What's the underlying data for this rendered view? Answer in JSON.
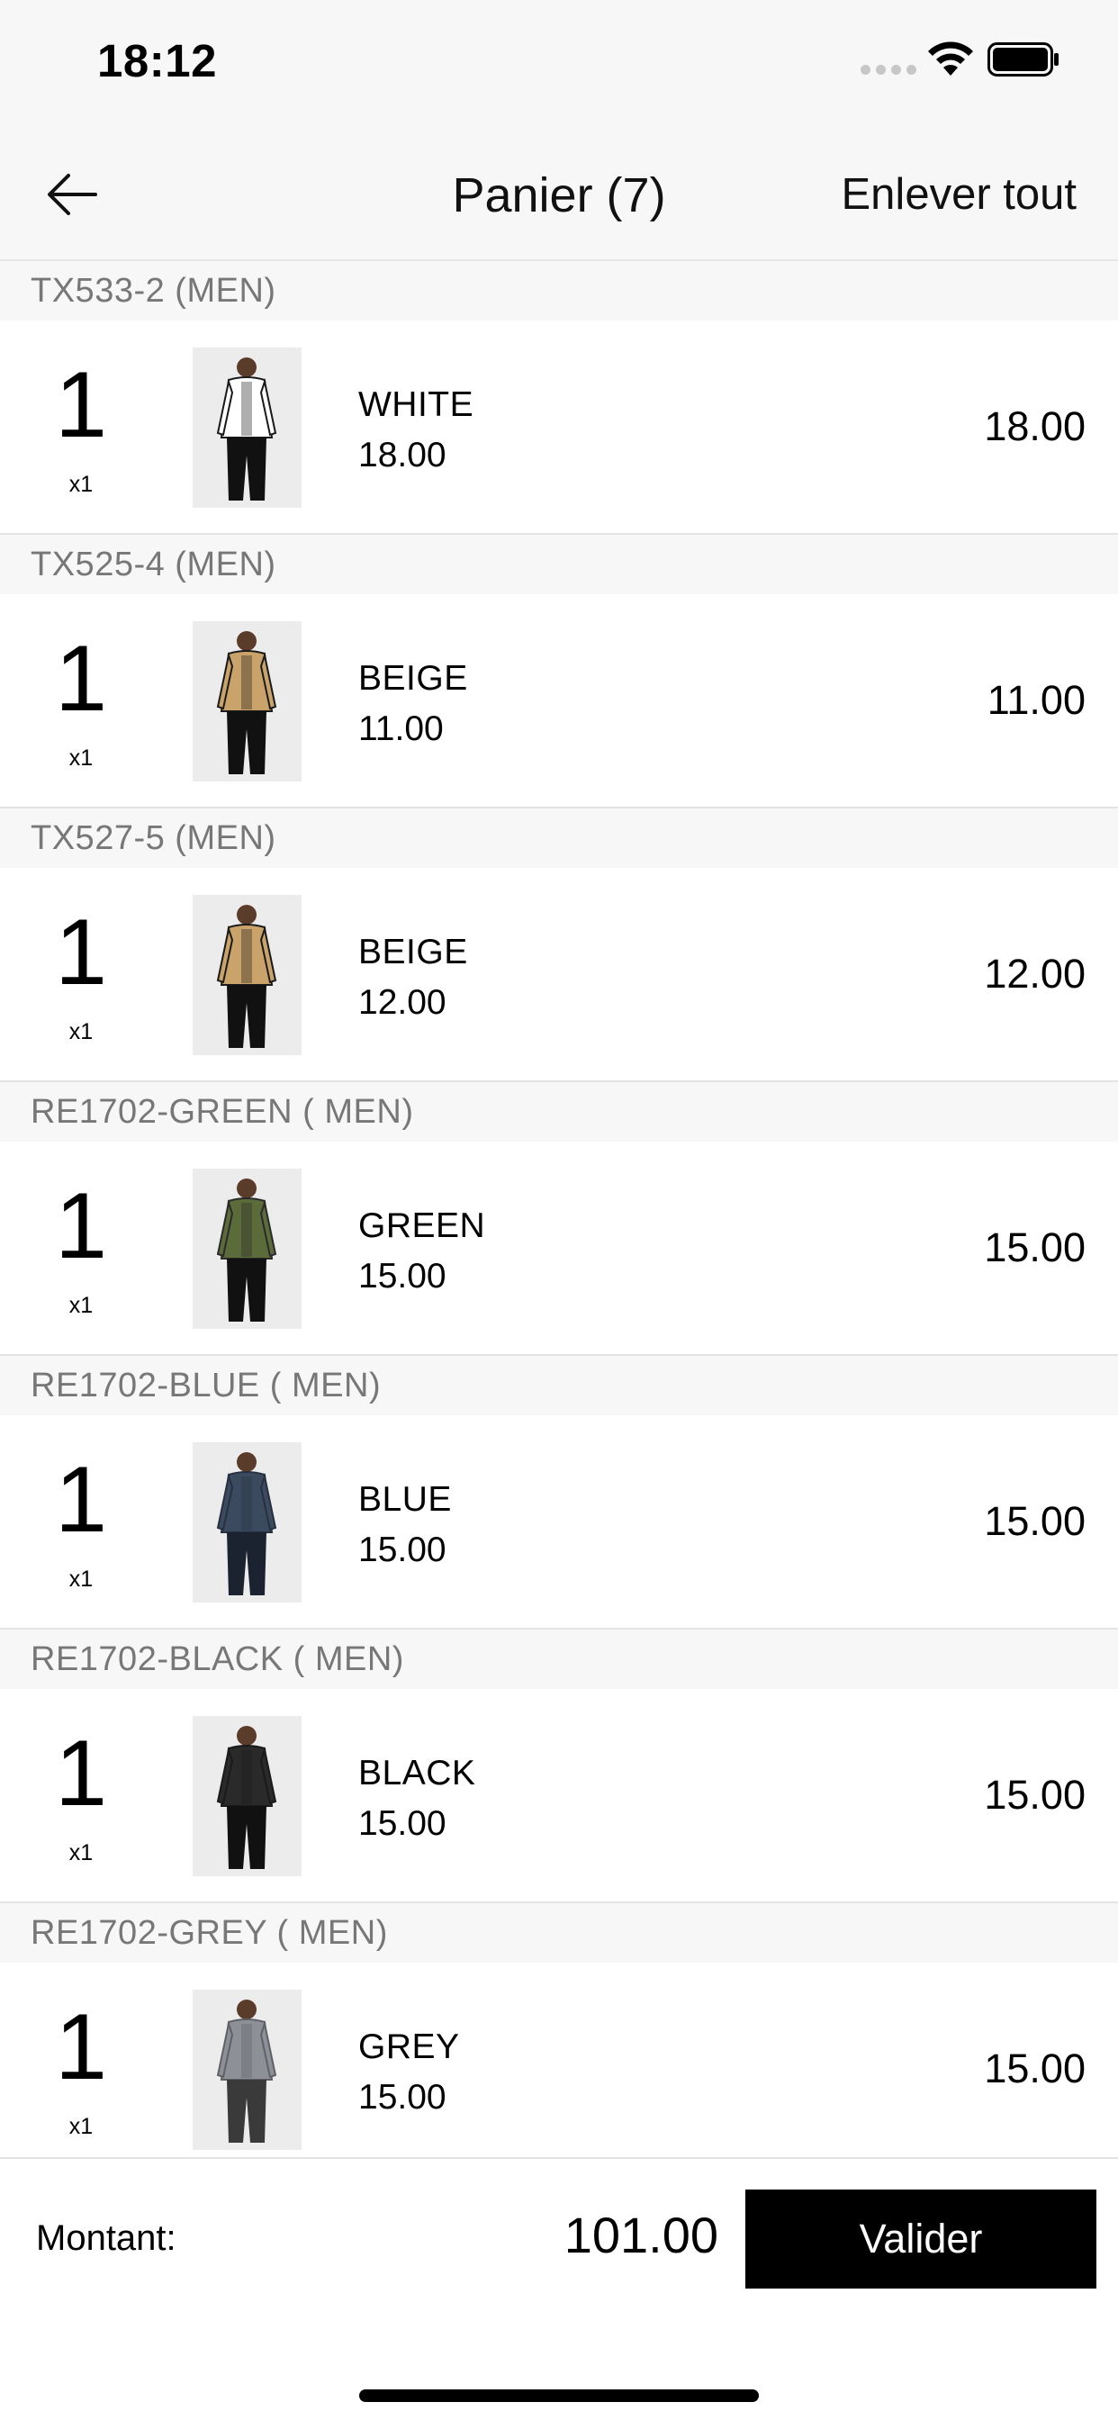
{
  "status_bar": {
    "time": "18:12"
  },
  "nav": {
    "title": "Panier (7)",
    "remove_all": "Enlever tout",
    "back_icon": "arrow-left-icon"
  },
  "items": [
    {
      "header": "TX533-2 (MEN)",
      "qty": "1",
      "qty_label": "x1",
      "color": "WHITE",
      "unit_price": "18.00",
      "total": "18.00",
      "jacket_color": "#ffffff",
      "accent_color": "#1a1a1a",
      "pants_color": "#111111"
    },
    {
      "header": "TX525-4 (MEN)",
      "qty": "1",
      "qty_label": "x1",
      "color": "BEIGE",
      "unit_price": "11.00",
      "total": "11.00",
      "jacket_color": "#c9a36a",
      "accent_color": "#1a1a1a",
      "pants_color": "#111111"
    },
    {
      "header": "TX527-5 (MEN)",
      "qty": "1",
      "qty_label": "x1",
      "color": "BEIGE",
      "unit_price": "12.00",
      "total": "12.00",
      "jacket_color": "#c9a36a",
      "accent_color": "#1a1a1a",
      "pants_color": "#111111"
    },
    {
      "header": "RE1702-GREEN ( MEN)",
      "qty": "1",
      "qty_label": "x1",
      "color": "GREEN",
      "unit_price": "15.00",
      "total": "15.00",
      "jacket_color": "#5b6b3a",
      "accent_color": "#2a2a2a",
      "pants_color": "#111111"
    },
    {
      "header": "RE1702-BLUE ( MEN)",
      "qty": "1",
      "qty_label": "x1",
      "color": "BLUE",
      "unit_price": "15.00",
      "total": "15.00",
      "jacket_color": "#3c4a60",
      "accent_color": "#27303f",
      "pants_color": "#1b2230"
    },
    {
      "header": "RE1702-BLACK ( MEN)",
      "qty": "1",
      "qty_label": "x1",
      "color": "BLACK",
      "unit_price": "15.00",
      "total": "15.00",
      "jacket_color": "#2a2a2a",
      "accent_color": "#1a1a1a",
      "pants_color": "#111111"
    },
    {
      "header": "RE1702-GREY ( MEN)",
      "qty": "1",
      "qty_label": "x1",
      "color": "GREY",
      "unit_price": "15.00",
      "total": "15.00",
      "jacket_color": "#8d9096",
      "accent_color": "#5f6166",
      "pants_color": "#3a3a3a"
    }
  ],
  "footer": {
    "amount_label": "Montant:",
    "amount_value": "101.00",
    "validate_label": "Valider"
  }
}
